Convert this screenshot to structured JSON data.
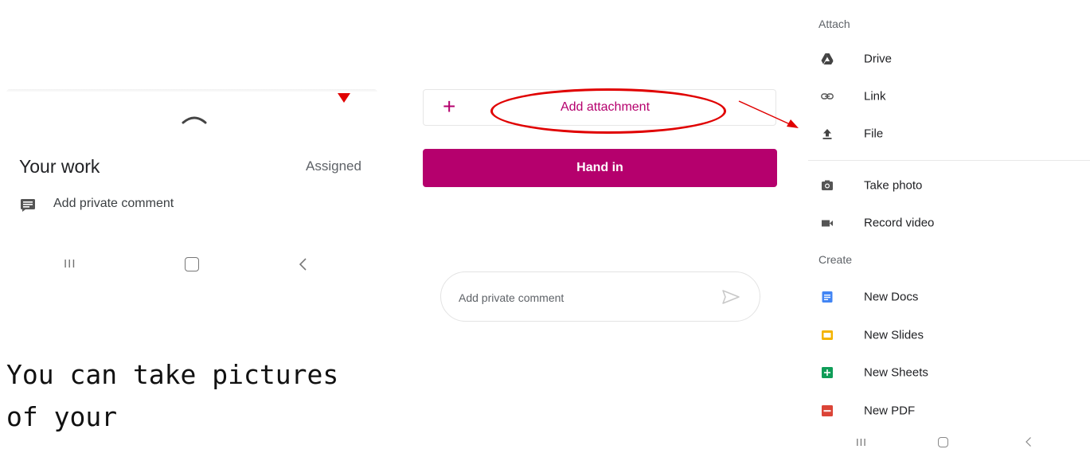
{
  "panel1": {
    "title": "Your work",
    "status": "Assigned",
    "comment_label": "Add private comment",
    "nav": {
      "recents": "III",
      "back": "<"
    }
  },
  "panel2": {
    "add_attachment": "Add attachment",
    "plus": "+",
    "hand_in": "Hand in",
    "comment_placeholder": "Add private comment"
  },
  "panel3": {
    "attach_header": "Attach",
    "attach_items": [
      {
        "label": "Drive",
        "icon": "drive-icon"
      },
      {
        "label": "Link",
        "icon": "link-icon"
      },
      {
        "label": "File",
        "icon": "upload-icon"
      }
    ],
    "capture_items": [
      {
        "label": "Take photo",
        "icon": "camera-icon"
      },
      {
        "label": "Record video",
        "icon": "video-icon"
      }
    ],
    "create_header": "Create",
    "create_items": [
      {
        "label": "New Docs",
        "icon": "docs-icon",
        "color": "#4285f4"
      },
      {
        "label": "New Slides",
        "icon": "slides-icon",
        "color": "#f4b400"
      },
      {
        "label": "New Sheets",
        "icon": "sheets-icon",
        "color": "#0f9d58"
      },
      {
        "label": "New PDF",
        "icon": "pdf-icon",
        "color": "#db4437"
      }
    ],
    "nav": {
      "recents": "III",
      "back": "<"
    }
  },
  "caption": "You can take pictures of your",
  "colors": {
    "accent": "#b5006d",
    "annotation": "#e00000"
  }
}
